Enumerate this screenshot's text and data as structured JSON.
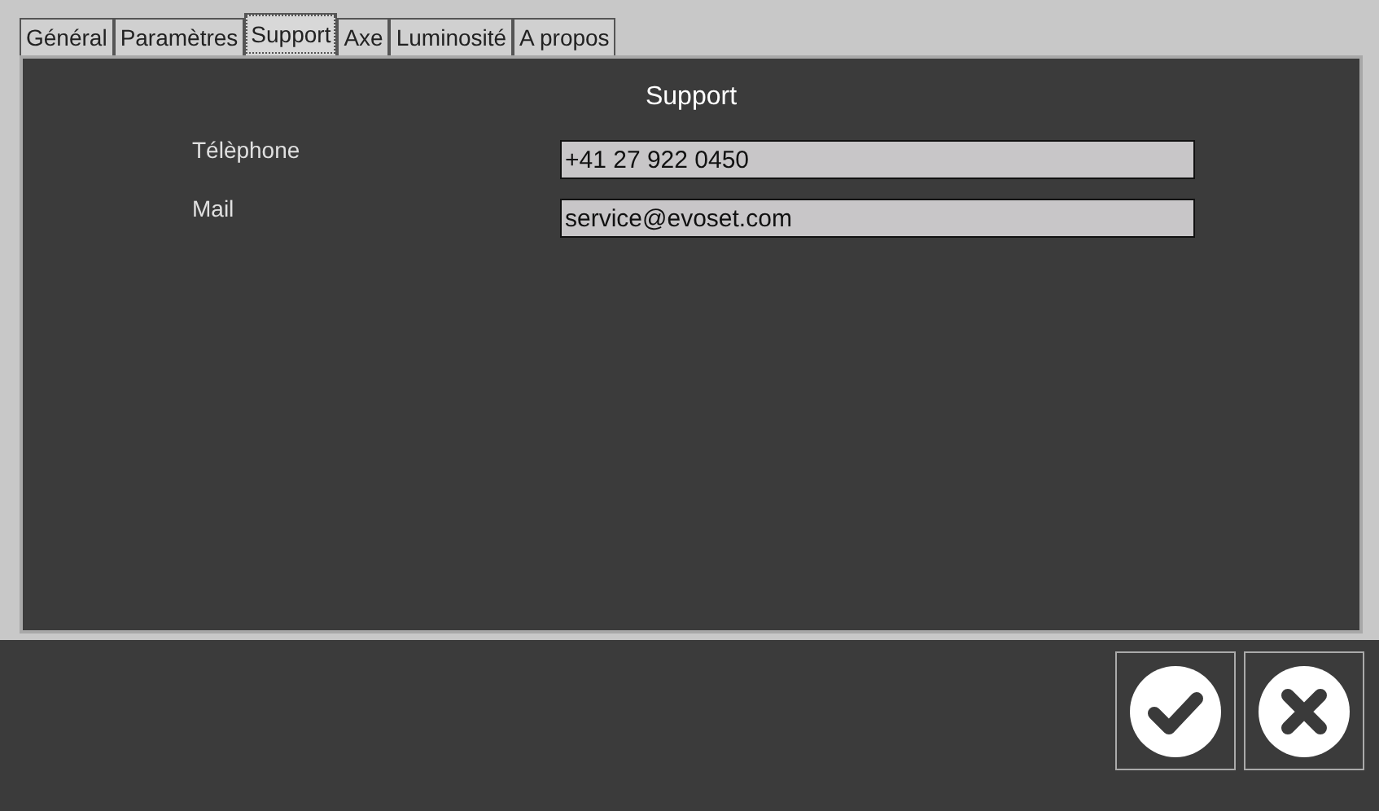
{
  "tabs": [
    {
      "label": "Général",
      "selected": false
    },
    {
      "label": "Paramètres",
      "selected": false
    },
    {
      "label": "Support",
      "selected": true
    },
    {
      "label": "Axe",
      "selected": false
    },
    {
      "label": "Luminosité",
      "selected": false
    },
    {
      "label": "A propos",
      "selected": false
    }
  ],
  "panel": {
    "title": "Support",
    "fields": [
      {
        "label": "Télèphone",
        "value": "+41 27 922 0450"
      },
      {
        "label": "Mail",
        "value": "service@evoset.com"
      }
    ]
  },
  "buttons": [
    {
      "kind": "confirm"
    },
    {
      "kind": "cancel"
    }
  ]
}
